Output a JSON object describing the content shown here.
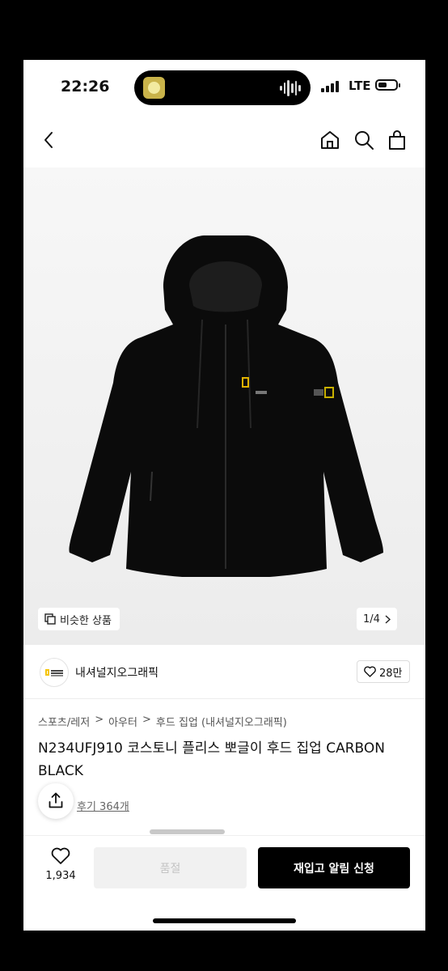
{
  "status_bar": {
    "time": "22:26",
    "network": "LTE"
  },
  "gallery": {
    "similar_label": "비슷한 상품",
    "page_indicator": "1/4"
  },
  "brand": {
    "name": "내셔널지오그래픽",
    "likes": "28만"
  },
  "breadcrumb": [
    "스포츠/레저",
    "아우터",
    "후드 집업 (내셔널지오그래픽)"
  ],
  "breadcrumb_sep": ">",
  "product": {
    "title": "N234UFJ910 코스토니 플리스 뽀글이 후드 집업 CARBON BLACK",
    "reviews": "후기 364개"
  },
  "bottom_bar": {
    "wish_count": "1,934",
    "soldout_label": "품절",
    "restock_label": "재입고 알림 신청"
  },
  "colors": {
    "accent": "#000000",
    "disabled_bg": "#f1f1f1",
    "disabled_text": "#c4c4c4"
  }
}
